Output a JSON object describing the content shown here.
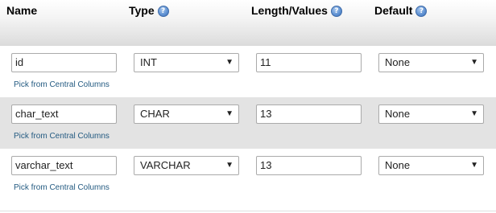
{
  "header": {
    "name": "Name",
    "type": "Type",
    "length": "Length/Values",
    "default": "Default",
    "help_icon_glyph": "?"
  },
  "rows": [
    {
      "name": "id",
      "type": "INT",
      "length": "11",
      "default": "None",
      "link": "Pick from Central Columns"
    },
    {
      "name": "char_text",
      "type": "CHAR",
      "length": "13",
      "default": "None",
      "link": "Pick from Central Columns"
    },
    {
      "name": "varchar_text",
      "type": "VARCHAR",
      "length": "13",
      "default": "None",
      "link": "Pick from Central Columns"
    }
  ],
  "icons": {
    "dropdown_arrow": "▼",
    "help": "help-circle-icon"
  },
  "colors": {
    "link": "#235a81",
    "alt_row": "#e3e3e3",
    "help_icon": "#5c8fd1"
  }
}
